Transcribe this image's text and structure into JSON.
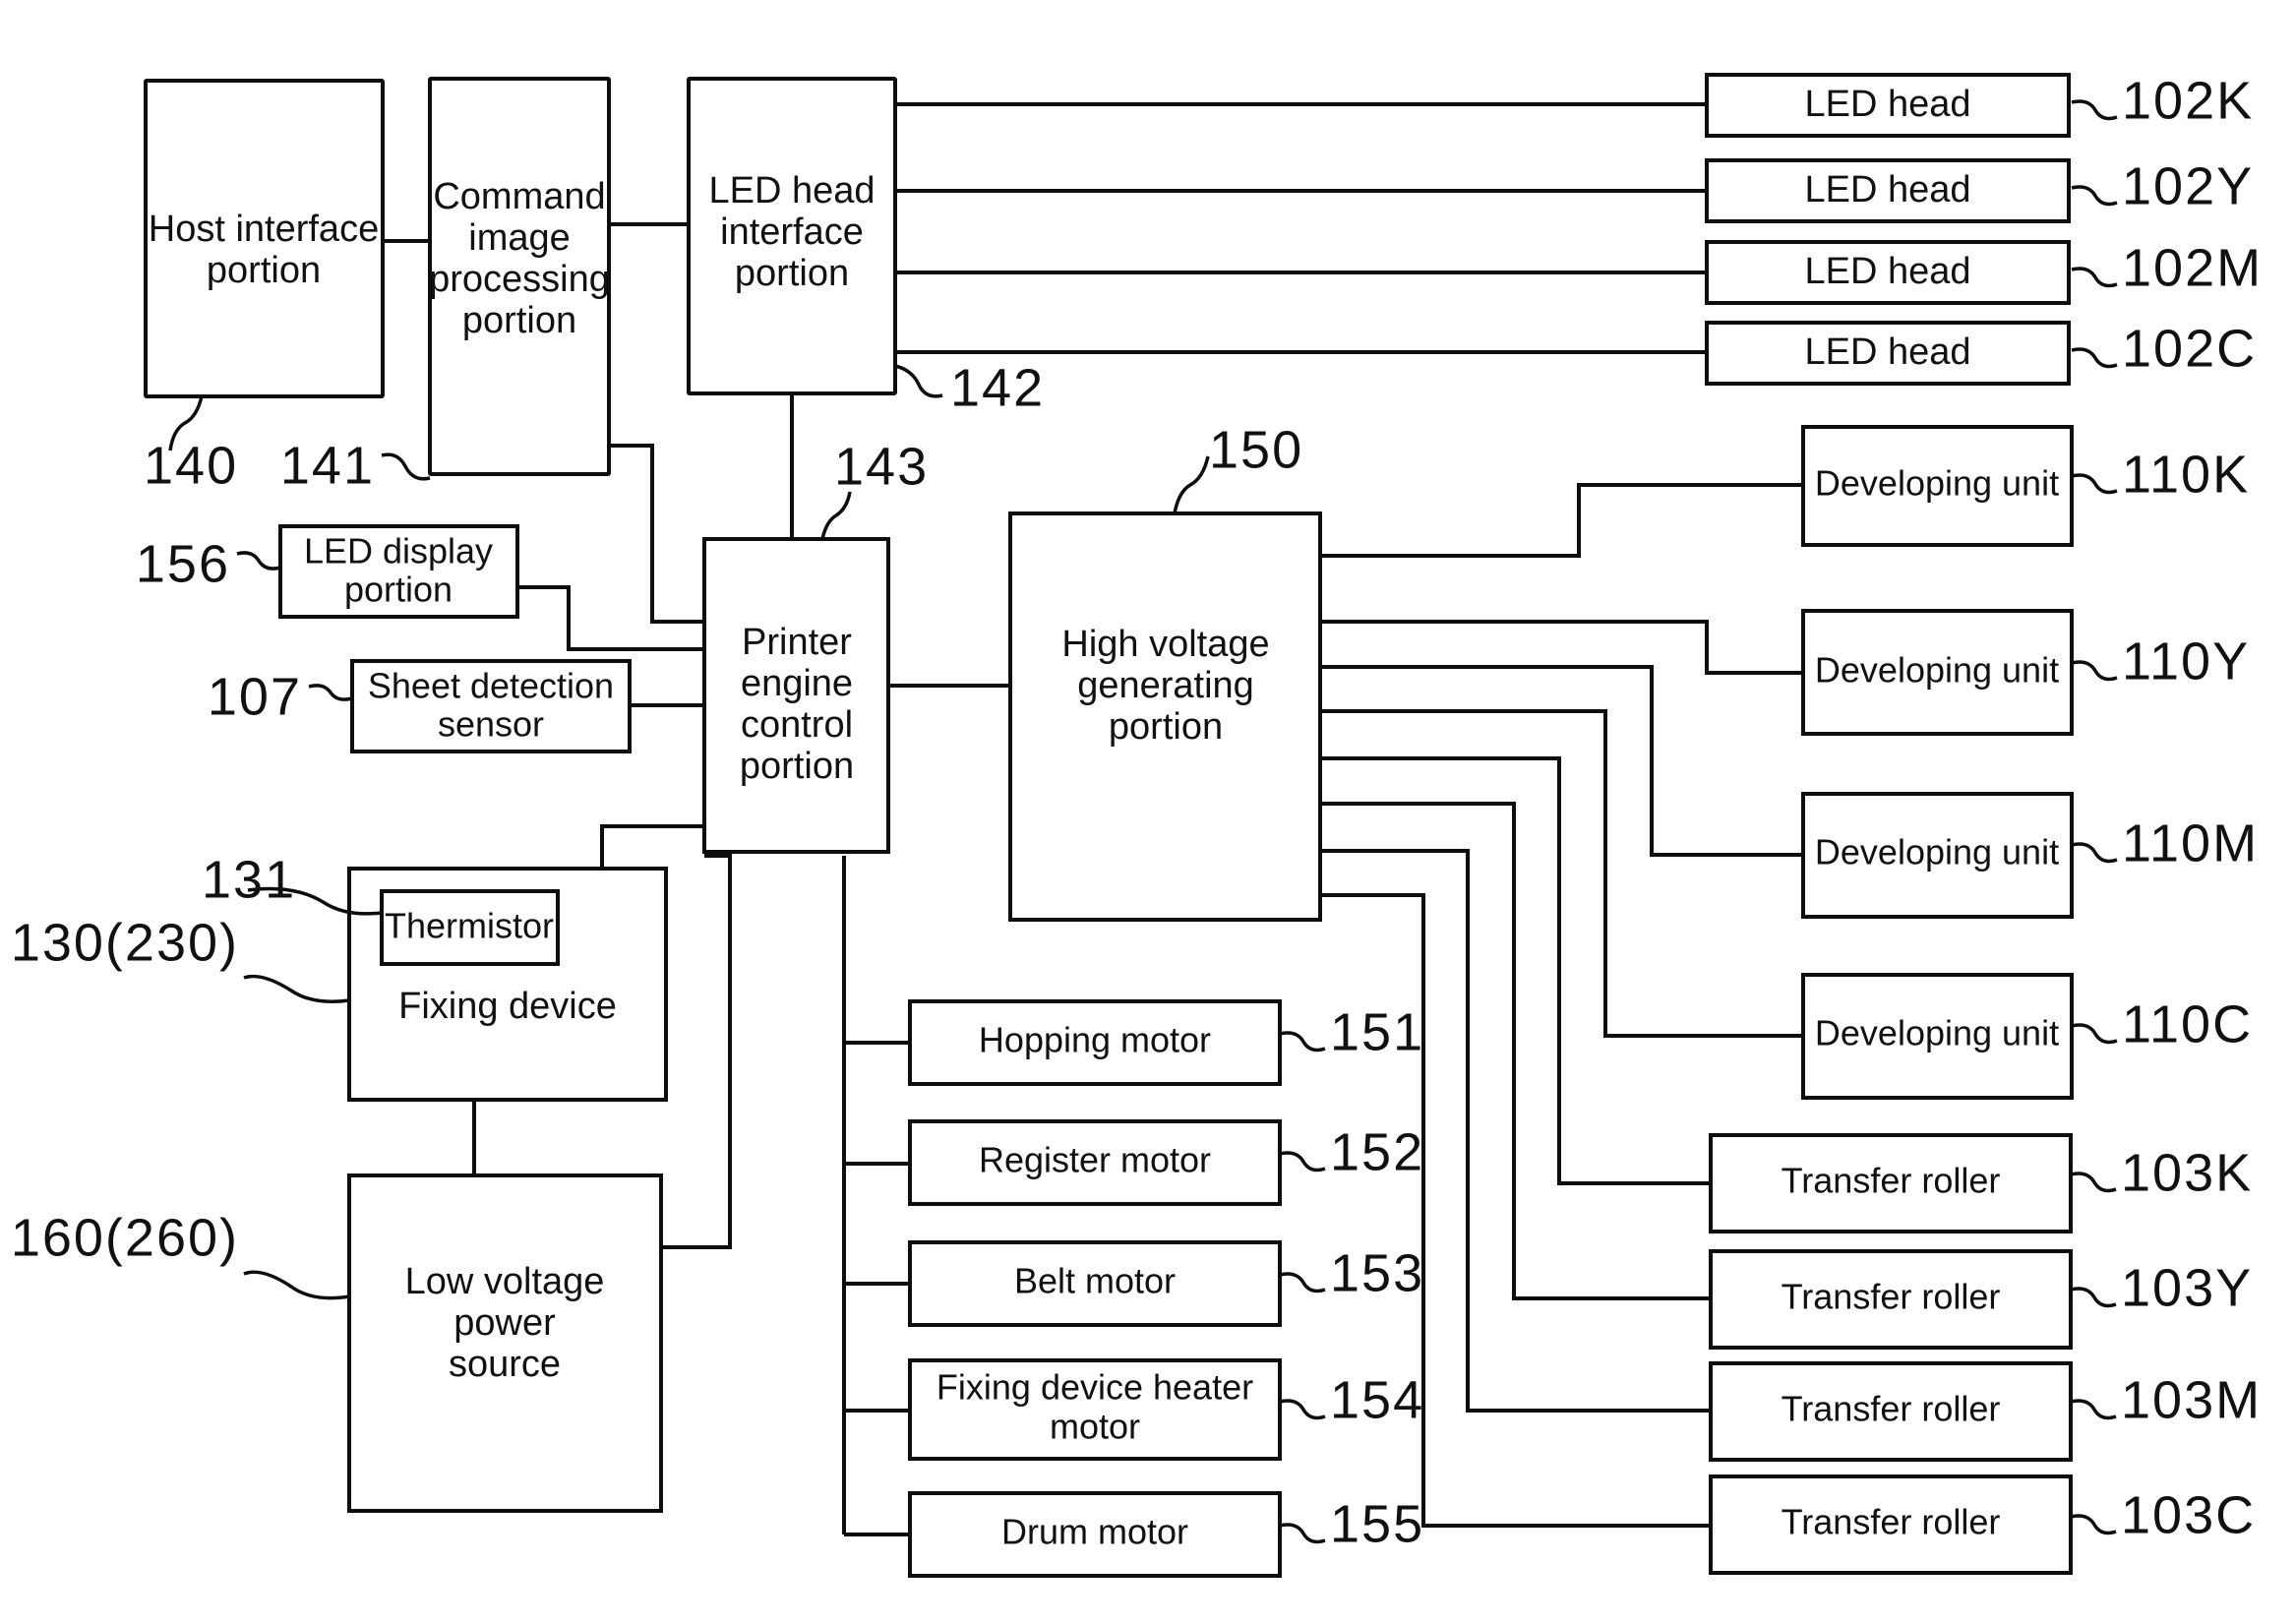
{
  "figure": {
    "type": "patent-block-diagram",
    "subject": "Electrophotographic color printer control block diagram"
  },
  "blocks": {
    "host_interface": {
      "label": "Host interface portion",
      "ref": "140"
    },
    "command_image_processing": {
      "label": "Command image processing portion",
      "ref": "141"
    },
    "led_head_interface": {
      "label": "LED head interface portion",
      "ref": "142"
    },
    "printer_engine_control": {
      "label": "Printer engine control portion",
      "ref": "143"
    },
    "high_voltage": {
      "label": "High voltage generating portion",
      "ref": "150"
    },
    "led_display": {
      "label": "LED display portion",
      "ref": "156"
    },
    "sheet_detection_sensor": {
      "label": "Sheet detection sensor",
      "ref": "107"
    },
    "thermistor": {
      "label": "Thermistor",
      "ref": "131"
    },
    "fixing_device": {
      "label": "Fixing device",
      "ref": "130(230)"
    },
    "low_voltage_power_source": {
      "label": "Low voltage power source",
      "ref": "160(260)"
    }
  },
  "led_heads": [
    {
      "label": "LED head",
      "ref": "102K"
    },
    {
      "label": "LED head",
      "ref": "102Y"
    },
    {
      "label": "LED head",
      "ref": "102M"
    },
    {
      "label": "LED head",
      "ref": "102C"
    }
  ],
  "developing_units": [
    {
      "label": "Developing unit",
      "ref": "110K"
    },
    {
      "label": "Developing unit",
      "ref": "110Y"
    },
    {
      "label": "Developing unit",
      "ref": "110M"
    },
    {
      "label": "Developing unit",
      "ref": "110C"
    }
  ],
  "transfer_rollers": [
    {
      "label": "Transfer roller",
      "ref": "103K"
    },
    {
      "label": "Transfer roller",
      "ref": "103Y"
    },
    {
      "label": "Transfer roller",
      "ref": "103M"
    },
    {
      "label": "Transfer roller",
      "ref": "103C"
    }
  ],
  "motors": [
    {
      "label": "Hopping motor",
      "ref": "151"
    },
    {
      "label": "Register motor",
      "ref": "152"
    },
    {
      "label": "Belt motor",
      "ref": "153"
    },
    {
      "label": "Fixing device heater motor",
      "ref": "154"
    },
    {
      "label": "Drum motor",
      "ref": "155"
    }
  ],
  "colors": {
    "ink": "#0d0d0d",
    "paper": "#ffffff"
  }
}
